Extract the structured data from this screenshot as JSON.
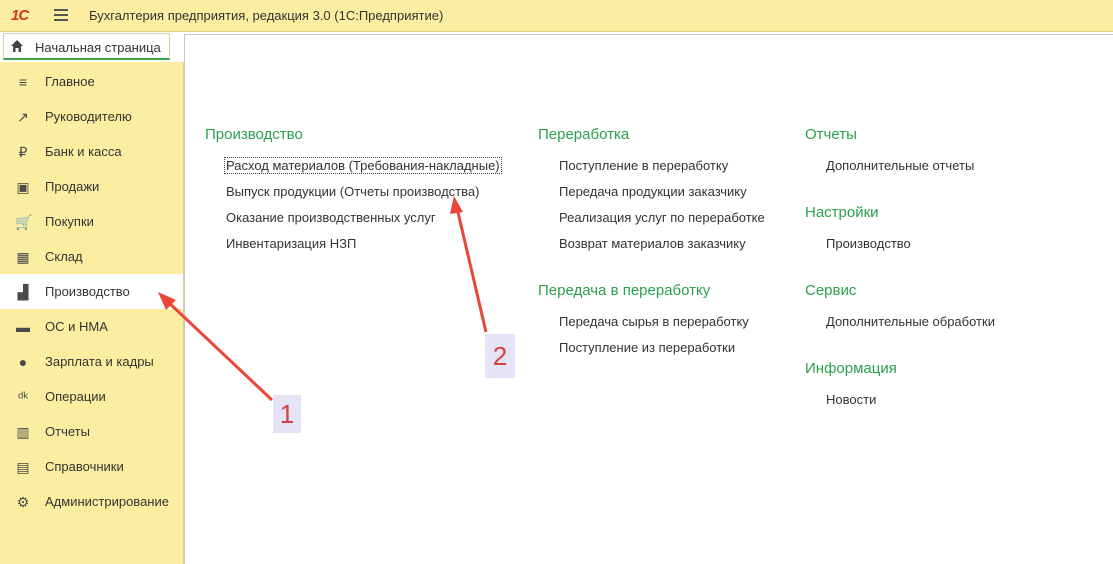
{
  "app": {
    "logo": "1С",
    "title": "Бухгалтерия предприятия, редакция 3.0  (1С:Предприятие)"
  },
  "home_tab": {
    "label": "Начальная страница"
  },
  "sidebar": {
    "items": [
      {
        "label": "Главное",
        "icon": "list-icon",
        "glyph": "≡"
      },
      {
        "label": "Руководителю",
        "icon": "trend-icon",
        "glyph": "↗"
      },
      {
        "label": "Банк и касса",
        "icon": "ruble-coin-icon",
        "glyph": "₽"
      },
      {
        "label": "Продажи",
        "icon": "bag-icon",
        "glyph": "▣"
      },
      {
        "label": "Покупки",
        "icon": "cart-icon",
        "glyph": "🛒"
      },
      {
        "label": "Склад",
        "icon": "grid-icon",
        "glyph": "▦"
      },
      {
        "label": "Производство",
        "icon": "factory-icon",
        "glyph": "▟"
      },
      {
        "label": "ОС и НМА",
        "icon": "truck-icon",
        "glyph": "▬"
      },
      {
        "label": "Зарплата и кадры",
        "icon": "person-icon",
        "glyph": "●"
      },
      {
        "label": "Операции",
        "icon": "debit-credit-icon",
        "glyph": "ᵈᵏ"
      },
      {
        "label": "Отчеты",
        "icon": "bar-chart-icon",
        "glyph": "▥"
      },
      {
        "label": "Справочники",
        "icon": "book-icon",
        "glyph": "▤"
      },
      {
        "label": "Администрирование",
        "icon": "gear-icon",
        "glyph": "⚙"
      }
    ]
  },
  "sections": [
    {
      "title": "Производство",
      "links": [
        "Расход материалов (Требования-накладные)",
        "Выпуск продукции (Отчеты производства)",
        "Оказание производственных услуг",
        "Инвентаризация НЗП"
      ]
    },
    {
      "title": "Переработка",
      "links": [
        "Поступление в переработку",
        "Передача продукции заказчику",
        "Реализация услуг по переработке",
        "Возврат материалов заказчику"
      ]
    },
    {
      "title": "Передача в переработку",
      "links": [
        "Передача сырья в переработку",
        "Поступление из переработки"
      ]
    },
    {
      "title": "Отчеты",
      "links": [
        "Дополнительные отчеты"
      ]
    },
    {
      "title": "Настройки",
      "links": [
        "Производство"
      ]
    },
    {
      "title": "Сервис",
      "links": [
        "Дополнительные обработки"
      ]
    },
    {
      "title": "Информация",
      "links": [
        "Новости"
      ]
    }
  ],
  "annotations": {
    "badge_1": "1",
    "badge_2": "2",
    "color": "#e8473a"
  },
  "colors": {
    "sidebar_bg": "#fbeea0",
    "section_title": "#2aa14c"
  }
}
